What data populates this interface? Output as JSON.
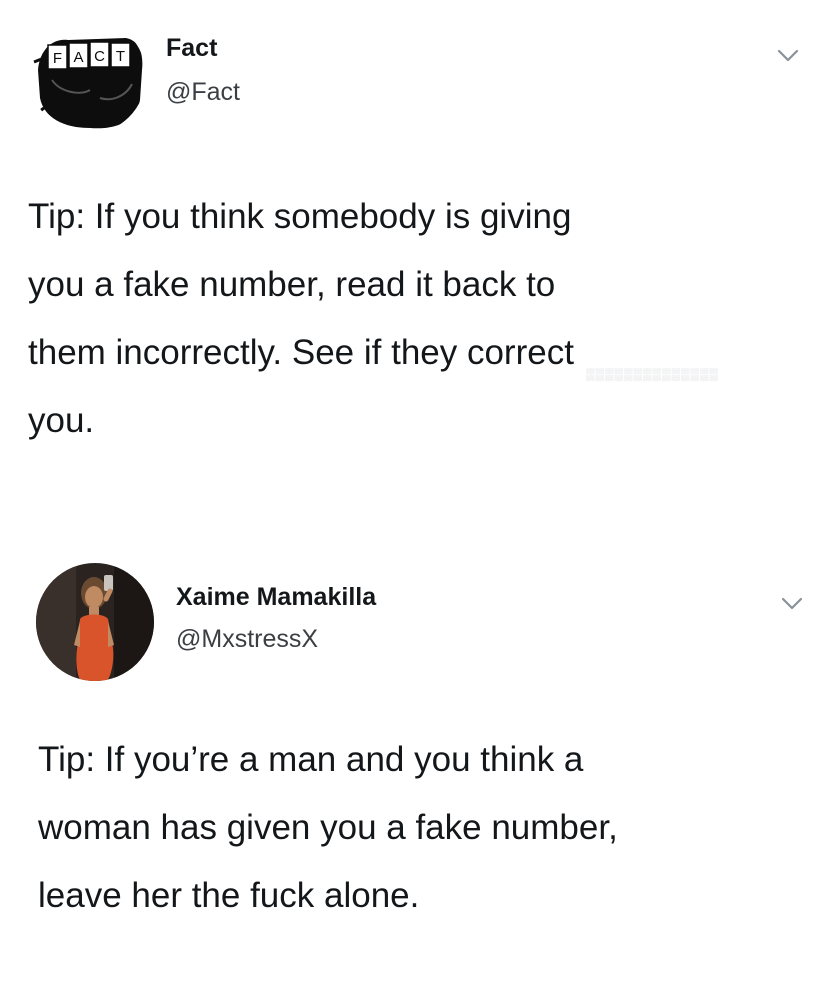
{
  "tweets": [
    {
      "display_name": "Fact",
      "handle": "@Fact",
      "avatar_icon": "fist-fact-logo",
      "avatar_logo_text": "FACT",
      "menu_icon": "chevron-down-icon",
      "text": "Tip: If you think somebody is giving\nyou a fake number, read it back to\nthem incorrectly. See if they correct\nyou."
    },
    {
      "display_name": "Xaime Mamakilla",
      "handle": "@MxstressX",
      "avatar_icon": "profile-photo",
      "menu_icon": "chevron-down-icon",
      "text": "Tip: If you’re a man and you think a\nwoman has given you a fake number,\nleave her the fuck alone."
    }
  ],
  "colors": {
    "background": "#ffffff",
    "text_primary": "#14171a",
    "text_secondary": "#3b3f44",
    "chevron": "#8a9199",
    "avatar_dress": "#d9542b"
  }
}
